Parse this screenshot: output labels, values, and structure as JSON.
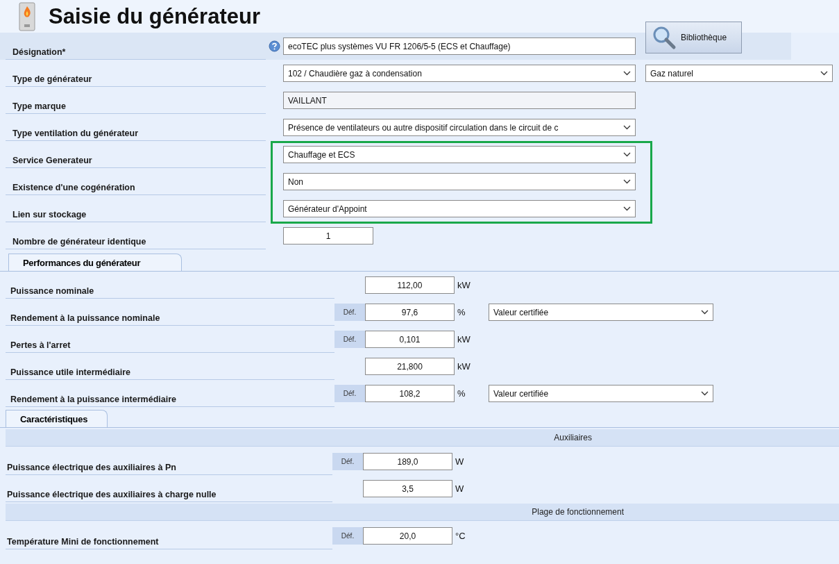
{
  "header": {
    "title": "Saisie du générateur"
  },
  "library_button": {
    "label": "Bibliothèque"
  },
  "general_fields": [
    {
      "kind": "text",
      "label": "Désignation*",
      "help": true,
      "highlighted": false,
      "value": "ecoTEC plus systèmes  VU FR 1206/5-5 (ECS et Chauffage)"
    },
    {
      "kind": "select",
      "label": "Type de générateur",
      "help": false,
      "highlighted": false,
      "value": "102 / Chaudière gaz à condensation",
      "secondary": "Gaz naturel"
    },
    {
      "kind": "readonly",
      "label": "Type marque",
      "help": false,
      "highlighted": false,
      "value": "VAILLANT"
    },
    {
      "kind": "select",
      "label": "Type ventilation du générateur",
      "help": false,
      "highlighted": false,
      "value": "Présence de ventilateurs ou autre dispositif circulation dans le circuit de c"
    },
    {
      "kind": "select",
      "label": "Service Generateur",
      "help": false,
      "highlighted": true,
      "value": "Chauffage et ECS"
    },
    {
      "kind": "select",
      "label": "Existence d'une cogénération",
      "help": false,
      "highlighted": true,
      "value": "Non"
    },
    {
      "kind": "select",
      "label": "Lien sur stockage",
      "help": false,
      "highlighted": true,
      "value": "Générateur d'Appoint"
    },
    {
      "kind": "number",
      "label": "Nombre de générateur identique",
      "help": false,
      "highlighted": false,
      "value": "1"
    }
  ],
  "performance": {
    "tab": "Performances du générateur",
    "rows": [
      {
        "label": "Puissance nominale",
        "value": "112,00",
        "unit": "kW"
      },
      {
        "label": "Rendement à la puissance nominale",
        "default_button": "Déf.",
        "value": "97,6",
        "unit": "%",
        "source": "Valeur certifiée"
      },
      {
        "label": "Pertes à l'arret",
        "default_button": "Déf.",
        "value": "0,101",
        "unit": "kW"
      },
      {
        "label": "Puissance utile intermédiaire",
        "value": "21,800",
        "unit": "kW"
      },
      {
        "label": "Rendement à la puissance intermédiaire",
        "default_button": "Déf.",
        "value": "108,2",
        "unit": "%",
        "source": "Valeur certifiée"
      }
    ]
  },
  "characteristics": {
    "tab": "Caractéristiques",
    "sections": [
      {
        "title": "Auxiliaires",
        "rows": [
          {
            "label": "Puissance électrique des auxiliaires à Pn",
            "default_button": "Déf.",
            "value": "189,0",
            "unit": "W"
          },
          {
            "label": "Puissance électrique des auxiliaires à charge nulle",
            "value": "3,5",
            "unit": "W"
          }
        ]
      },
      {
        "title": "Plage de fonctionnement",
        "rows": [
          {
            "label": "Température Mini de fonctionnement",
            "default_button": "Déf.",
            "value": "20,0",
            "unit": "°C"
          }
        ]
      }
    ]
  }
}
